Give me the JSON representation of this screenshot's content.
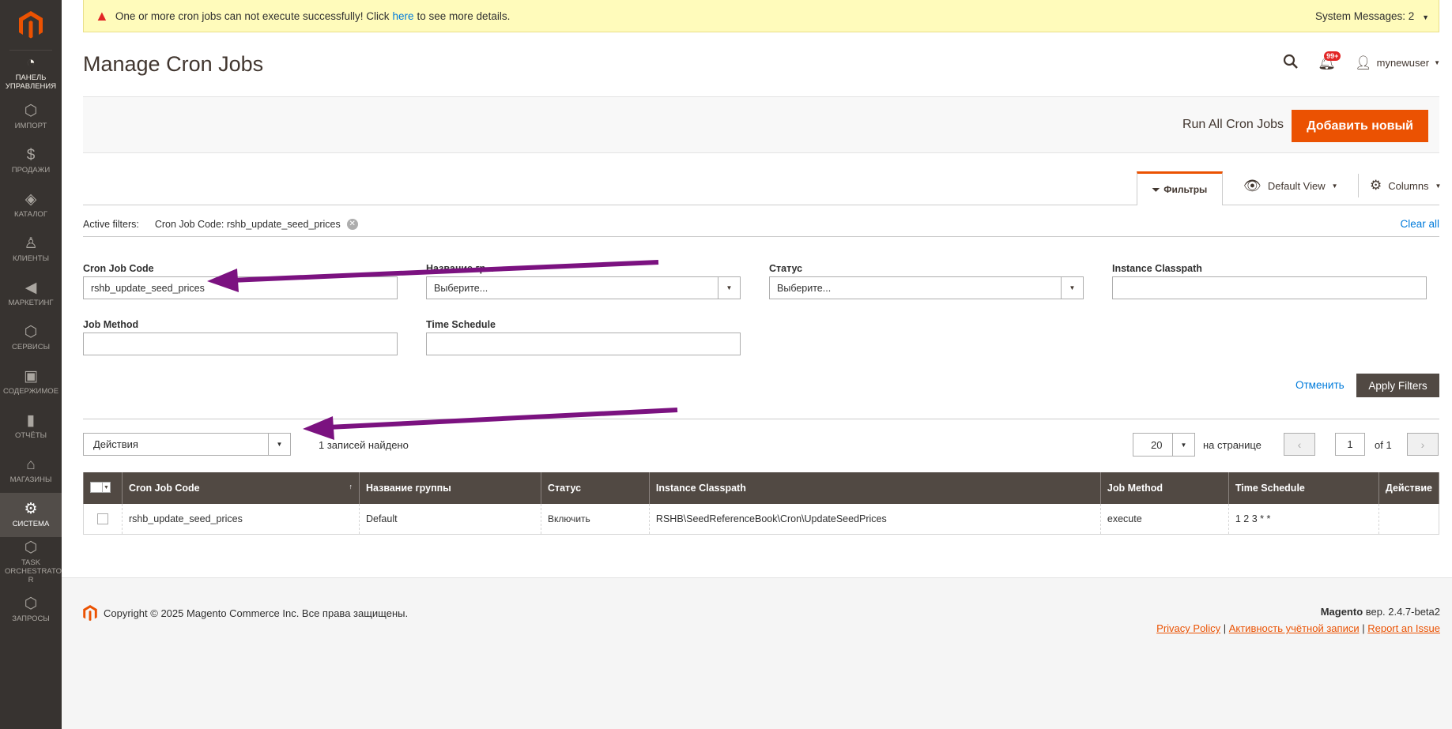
{
  "sidebar": {
    "items": [
      {
        "label": "ПАНЕЛЬ УПРАВЛЕНИЯ",
        "icon": "dashboard-icon"
      },
      {
        "label": "ИМПОРТ",
        "icon": "hexagon-icon"
      },
      {
        "label": "ПРОДАЖИ",
        "icon": "dollar-icon"
      },
      {
        "label": "КАТАЛОГ",
        "icon": "box-icon"
      },
      {
        "label": "КЛИЕНТЫ",
        "icon": "person-icon"
      },
      {
        "label": "МАРКЕТИНГ",
        "icon": "megaphone-icon"
      },
      {
        "label": "СЕРВИСЫ",
        "icon": "hexagon-icon"
      },
      {
        "label": "СОДЕРЖИМОЕ",
        "icon": "layout-icon"
      },
      {
        "label": "ОТЧЁТЫ",
        "icon": "bar-chart-icon"
      },
      {
        "label": "МАГАЗИНЫ",
        "icon": "store-icon"
      },
      {
        "label": "СИСТЕМА",
        "icon": "gear-icon"
      },
      {
        "label": "TASK ORCHESTRATO R",
        "icon": "hexagon-icon"
      },
      {
        "label": "ЗАПРОСЫ",
        "icon": "hexagon-icon"
      }
    ]
  },
  "system_message": {
    "text_before": "One or more cron jobs can not execute successfully! Click",
    "link": "here",
    "text_after": "to see more details.",
    "right": "System Messages: 2"
  },
  "header": {
    "title": "Manage Cron Jobs",
    "notifications_badge": "99+",
    "username": "mynewuser"
  },
  "actions": {
    "run_all": "Run All Cron Jobs",
    "add_new": "Добавить новый"
  },
  "toolbar": {
    "filters_tab": "Фильтры",
    "default_view": "Default View",
    "columns": "Columns"
  },
  "active_filters": {
    "label": "Active filters:",
    "chip": "Cron Job Code: rshb_update_seed_prices",
    "clear_all": "Clear all"
  },
  "filters": {
    "cron_job_code": {
      "label": "Cron Job Code",
      "value": "rshb_update_seed_prices"
    },
    "group_name": {
      "label": "Название гр...",
      "value": "Выберите..."
    },
    "status": {
      "label": "Статус",
      "value": "Выберите..."
    },
    "instance_classpath": {
      "label": "Instance Classpath",
      "value": ""
    },
    "job_method": {
      "label": "Job Method",
      "value": ""
    },
    "time_schedule": {
      "label": "Time Schedule",
      "value": ""
    },
    "cancel": "Отменить",
    "apply": "Apply Filters"
  },
  "grid_controls": {
    "actions": "Действия",
    "records_found": "1 записей найдено",
    "per_page_value": "20",
    "per_page_label": "на странице",
    "page": "1",
    "of": "of 1"
  },
  "grid": {
    "columns": [
      "Cron Job Code",
      "Название группы",
      "Статус",
      "Instance Classpath",
      "Job Method",
      "Time Schedule",
      "Действие"
    ],
    "rows": [
      [
        "rshb_update_seed_prices",
        "Default",
        "Включить",
        "RSHB\\SeedReferenceBook\\Cron\\UpdateSeedPrices",
        "execute",
        "1 2 3 * *",
        ""
      ]
    ]
  },
  "footer": {
    "copyright": "Copyright © 2025 Magento Commerce Inc. Все права защищены.",
    "brand": "Magento",
    "version": "вер. 2.4.7-beta2",
    "privacy": "Privacy Policy",
    "activity": "Активность учётной записи",
    "report": "Report an Issue"
  },
  "colors": {
    "accent": "#eb5202",
    "sidebar": "#373330",
    "grid_header": "#514943",
    "annotation_arrow": "#7b1280"
  }
}
